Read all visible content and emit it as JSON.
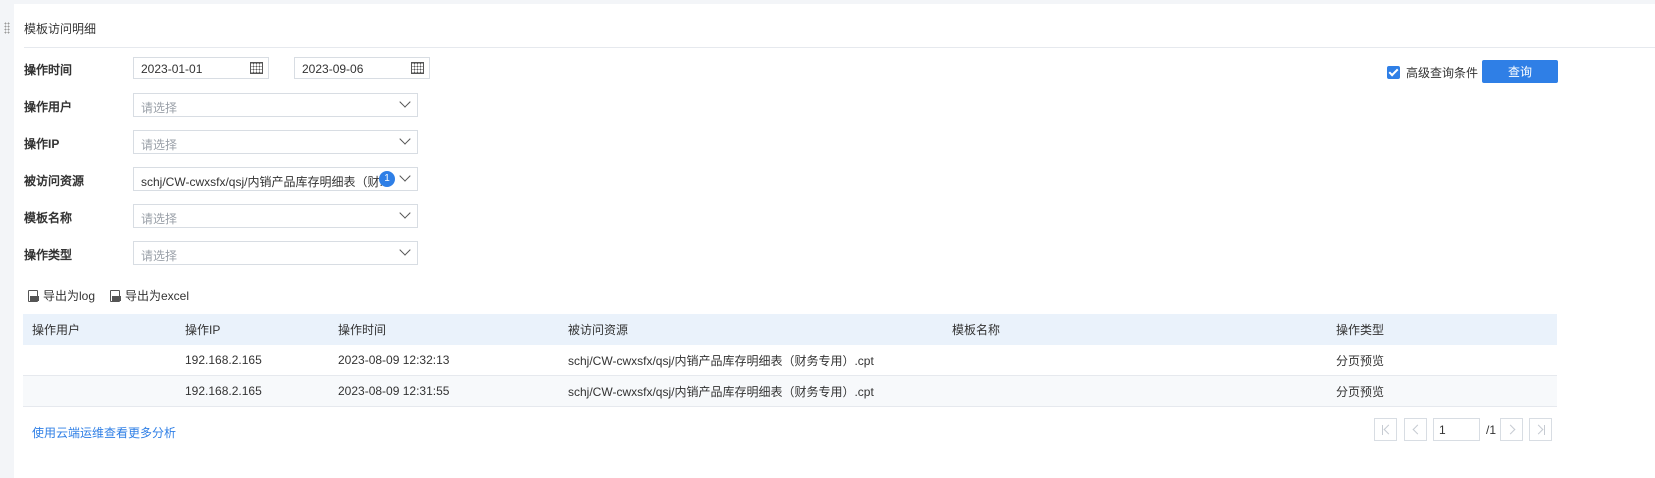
{
  "panel": {
    "title": "模板访问明细"
  },
  "filters": {
    "time_label": "操作时间",
    "date_from": "2023-01-01",
    "date_to": "2023-09-06",
    "date_sep": "-",
    "user_label": "操作用户",
    "user_placeholder": "请选择",
    "ip_label": "操作IP",
    "ip_placeholder": "请选择",
    "resource_label": "被访问资源",
    "resource_value": "schj/CW-cwxsfx/qsj/内销产品库存明细表（财...",
    "resource_count": "1",
    "template_label": "模板名称",
    "template_placeholder": "请选择",
    "type_label": "操作类型",
    "type_placeholder": "请选择"
  },
  "advanced": {
    "label": "高级查询条件",
    "checked": true
  },
  "query_button": "查询",
  "export": {
    "log": "导出为log",
    "excel": "导出为excel"
  },
  "table": {
    "headers": [
      "操作用户",
      "操作IP",
      "操作时间",
      "被访问资源",
      "模板名称",
      "操作类型"
    ],
    "rows": [
      [
        "",
        "192.168.2.165",
        "2023-08-09 12:32:13",
        "schj/CW-cwxsfx/qsj/内销产品库存明细表（财务专用）.cpt",
        "",
        "分页预览"
      ],
      [
        "",
        "192.168.2.165",
        "2023-08-09 12:31:55",
        "schj/CW-cwxsfx/qsj/内销产品库存明细表（财务专用）.cpt",
        "",
        "分页预览"
      ]
    ]
  },
  "footer": {
    "more_link": "使用云端运维查看更多分析",
    "page_value": "1",
    "page_total": "/1"
  }
}
